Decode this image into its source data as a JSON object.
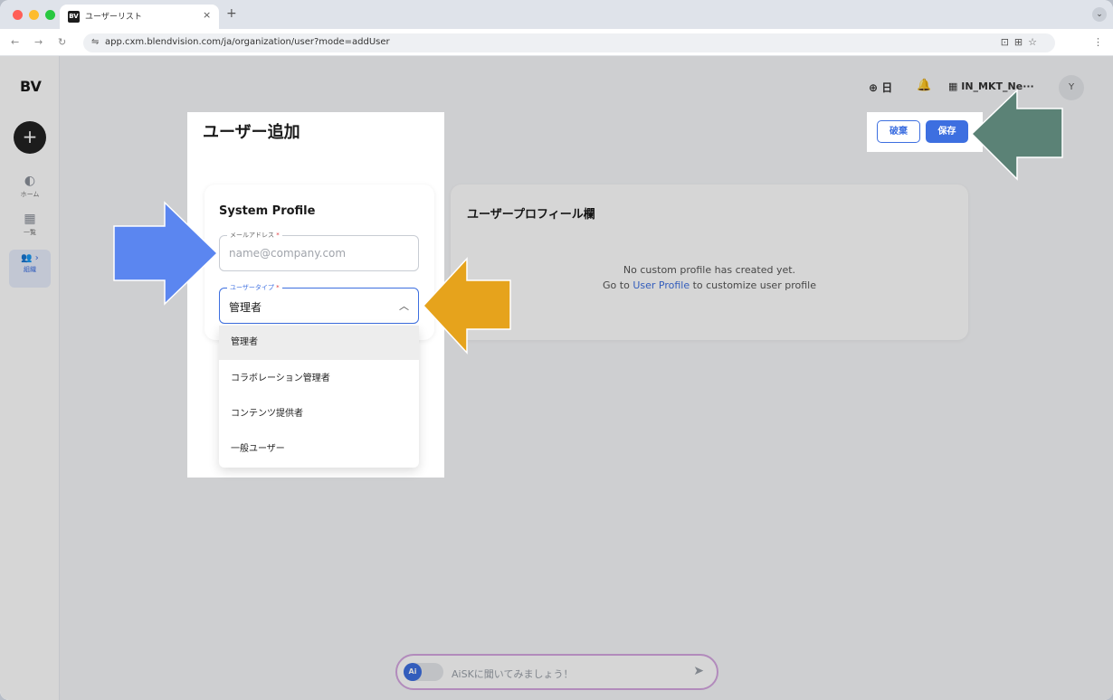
{
  "browser": {
    "tab_title": "ユーザーリスト",
    "tab_favicon": "BV",
    "tab_close": "×",
    "new_tab": "+",
    "url": "app.cxm.blendvision.com/ja/organization/user?mode=addUser"
  },
  "sidebar": {
    "logo": "BV",
    "add_symbol": "+",
    "items": [
      {
        "label": "ホーム",
        "icon": "home-icon",
        "glyph": "◐"
      },
      {
        "label": "一覧",
        "icon": "grid-icon",
        "glyph": "▦"
      },
      {
        "label": "組織",
        "icon": "users-icon",
        "glyph": "👥 ›"
      }
    ]
  },
  "topbar": {
    "language": "日",
    "org_name": "IN_MKT_Ne···",
    "avatar": "Y"
  },
  "page": {
    "title": "ユーザー追加",
    "discard_label": "破棄",
    "save_label": "保存"
  },
  "system_profile": {
    "title": "System Profile",
    "email_label": "メールアドレス",
    "email_required": "*",
    "email_placeholder": "name@company.com",
    "user_type_label": "ユーザータイプ",
    "user_type_required": "*",
    "user_type_value": "管理者",
    "user_type_options": [
      "管理者",
      "コラボレーション管理者",
      "コンテンツ提供者",
      "一般ユーザー"
    ]
  },
  "user_profile": {
    "title": "ユーザープロフィール欄",
    "empty_line1": "No custom profile has created yet.",
    "empty_prefix": "Go to ",
    "empty_link": "User Profile",
    "empty_suffix": " to customize user profile"
  },
  "ai_bar": {
    "badge": "Ai",
    "placeholder": "AiSKに聞いてみましょう！"
  },
  "colors": {
    "accent": "#3d6fe0",
    "arrow_blue": "#5b86f0",
    "arrow_orange": "#e6a31c",
    "arrow_green": "#5b8276"
  }
}
